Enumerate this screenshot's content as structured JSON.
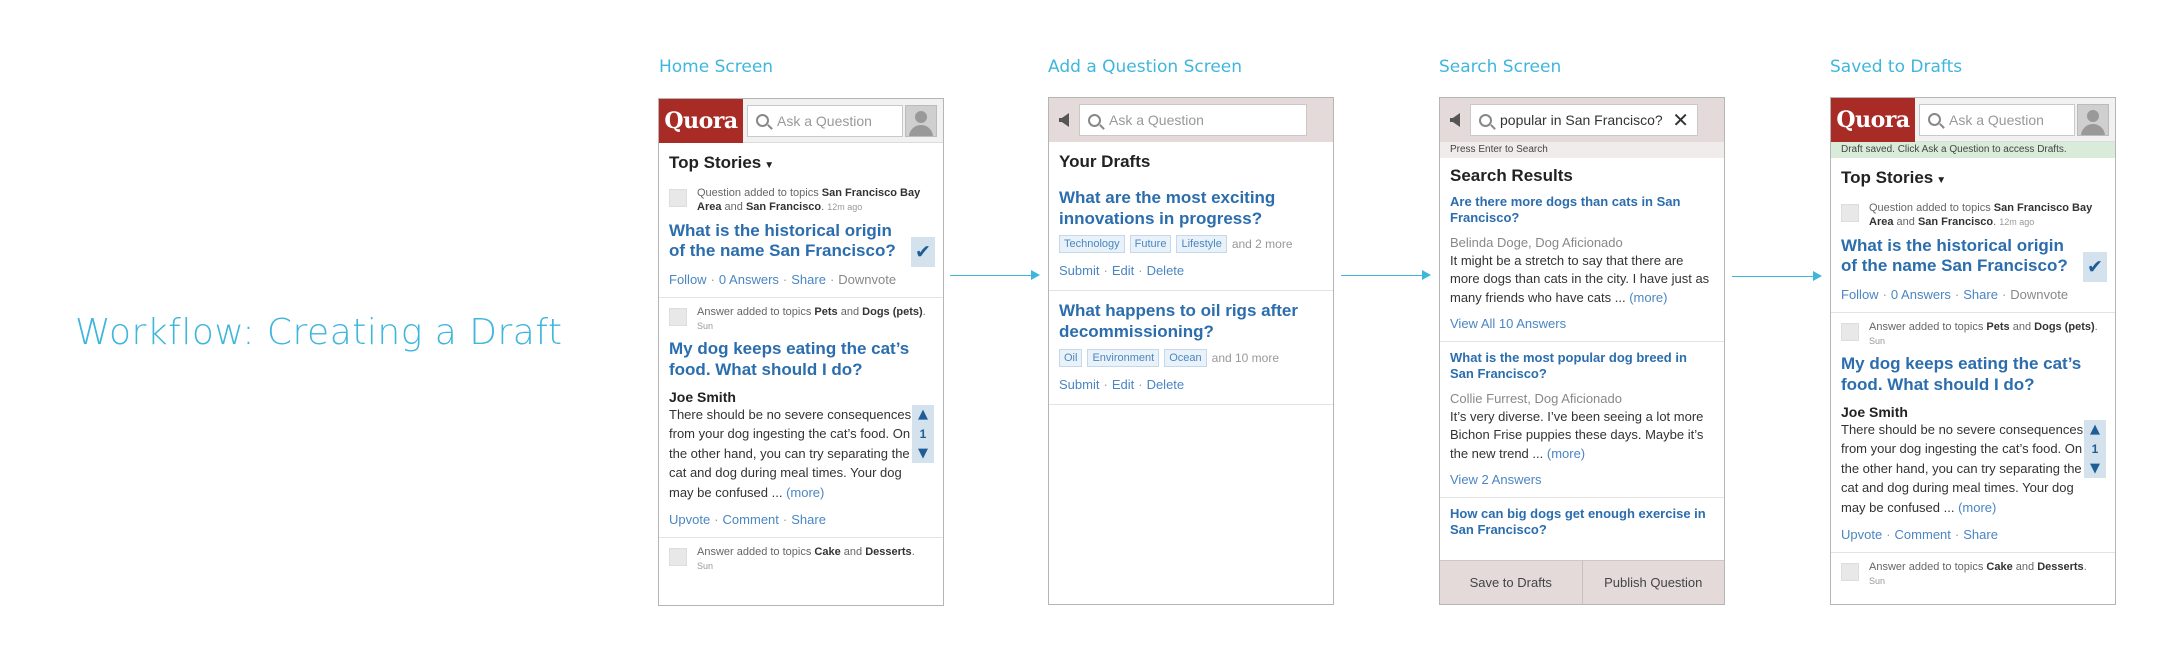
{
  "workflow_title": "Workflow: Creating a Draft",
  "colors": {
    "accent": "#3fb6dc",
    "quora_red": "#a82b25",
    "link": "#2b6dad"
  },
  "labels": {
    "home": "Home Screen",
    "add_question": "Add a Question Screen",
    "search": "Search Screen",
    "saved": "Saved to Drafts"
  },
  "common": {
    "logo": "Quora",
    "search_placeholder": "Ask a Question",
    "top_stories": "Top Stories",
    "caret": "▼",
    "check": "✔"
  },
  "feed": {
    "item1": {
      "meta_prefix": "Question added to topics",
      "topic1": "San Francisco Bay Area",
      "and": "and",
      "topic2": "San Francisco",
      "time": "12m ago",
      "title": "What is the historical origin of the name San Francisco?",
      "follow": "Follow",
      "answers": "0 Answers",
      "share": "Share",
      "downvote": "Downvote"
    },
    "item2": {
      "meta_prefix": "Answer added to topics",
      "topic1": "Pets",
      "and": "and",
      "topic2": "Dogs (pets)",
      "time": "Sun",
      "title": "My dog keeps eating the cat’s food. What should I do?",
      "author": "Joe Smith",
      "text": "There should be no severe consequences from your dog ingesting the cat’s food. On the other hand, you can try separating the cat and dog during meal times. Your dog may be confused ...",
      "more": "(more)",
      "votes": "1",
      "upvote": "Upvote",
      "comment": "Comment",
      "share": "Share"
    },
    "item3": {
      "meta_prefix": "Answer added to topics",
      "topic1": "Cake",
      "and": "and",
      "topic2": "Desserts",
      "time": "Sun"
    }
  },
  "drafts": {
    "title": "Your Drafts",
    "items": [
      {
        "title": "What are the most exciting innovations in progress?",
        "tags": [
          "Technology",
          "Future",
          "Lifestyle"
        ],
        "more_tags": "and 2 more"
      },
      {
        "title": "What happens to oil rigs after decommissioning?",
        "tags": [
          "Oil",
          "Environment",
          "Ocean"
        ],
        "more_tags": "and 10 more"
      }
    ],
    "submit": "Submit",
    "edit": "Edit",
    "delete": "Delete"
  },
  "search": {
    "query": "popular in San Francisco?",
    "hint": "Press Enter to Search",
    "results_title": "Search Results",
    "results": [
      {
        "title": "Are there more dogs than cats in San Francisco?",
        "author": "Belinda Doge, Dog Aficionado",
        "text": "It might be a stretch to say that there are more dogs than cats in the city. I have just as many friends who have cats ...",
        "more": "(more)",
        "link": "View All 10 Answers"
      },
      {
        "title": "What is the most popular dog breed in San Francisco?",
        "author": "Collie Furrest, Dog Aficionado",
        "text": "It’s very diverse. I’ve been seeing a lot more Bichon Frise puppies these days. Maybe it’s the new trend ...",
        "more": "(more)",
        "link": "View 2 Answers"
      },
      {
        "title": "How can big dogs get enough exercise in San Francisco?"
      }
    ],
    "save_to_drafts": "Save to Drafts",
    "publish": "Publish Question"
  },
  "saved": {
    "banner": "Draft saved. Click Ask a Question to access Drafts."
  }
}
